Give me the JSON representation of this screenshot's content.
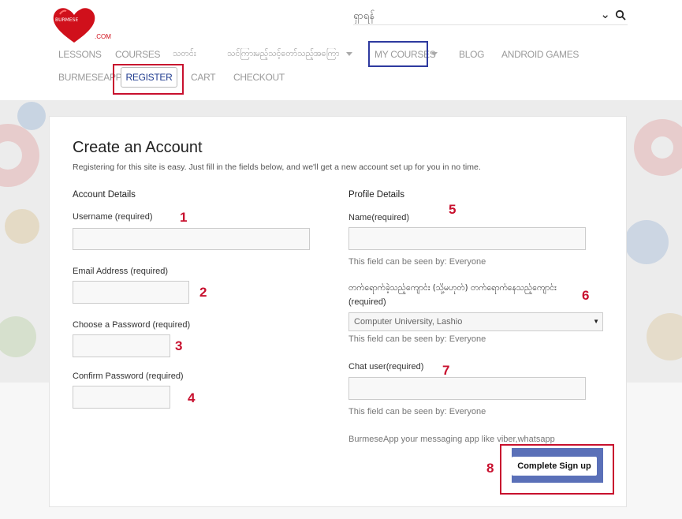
{
  "logo": {
    "top_text": "BURMESE",
    "bottom_text": ".COM",
    "brand_color": "#d0101b"
  },
  "search": {
    "text": "ရှာရန်"
  },
  "nav": {
    "row1": [
      {
        "id": "lessons",
        "label": "LESSONS"
      },
      {
        "id": "courses",
        "label": "COURSES"
      },
      {
        "id": "news",
        "label": "သတင်း"
      },
      {
        "id": "burmese-text",
        "label": "သင်ကြားမည့်သင့်တော်သည့်အကြောင်းအရာ"
      },
      {
        "id": "my-courses",
        "label": "MY COURSES"
      },
      {
        "id": "blog",
        "label": "BLOG"
      },
      {
        "id": "android-games",
        "label": "ANDROID GAMES"
      }
    ],
    "row2": [
      {
        "id": "burmeseapp",
        "label": "BURMESEAPP"
      },
      {
        "id": "register",
        "label": "REGISTER"
      },
      {
        "id": "cart",
        "label": "CART"
      },
      {
        "id": "checkout",
        "label": "CHECKOUT"
      }
    ]
  },
  "form": {
    "title": "Create an Account",
    "subtitle": "Registering for this site is easy. Just fill in the fields below, and we'll get a new account set up for you in no time.",
    "account": {
      "heading": "Account Details",
      "username_label": "Username (required)",
      "email_label": "Email Address (required)",
      "password_label": "Choose a Password (required)",
      "confirm_label": "Confirm Password (required)"
    },
    "profile": {
      "heading": "Profile Details",
      "name_label": "Name(required)",
      "university_label_1": "တက်ရောက်ခဲ့သည့်ကျောင်း (သို့မဟုတ်) တက်ရောက်နေသည့်ကျောင်း",
      "university_label_2": "(required)",
      "university_value": "Computer University, Lashio",
      "chat_label": "Chat user(required)",
      "visibility_hint": "This field can be seen by: Everyone",
      "app_note": "BurmeseApp your messaging app like viber,whatsapp"
    },
    "submit_label": "Complete Sign up"
  },
  "annotations": [
    "1",
    "2",
    "3",
    "4",
    "5",
    "6",
    "7",
    "8"
  ],
  "colors": {
    "annotation_red": "#c8102e",
    "annotation_blue": "#2e3a9f",
    "button_blue": "#5a70b8"
  }
}
